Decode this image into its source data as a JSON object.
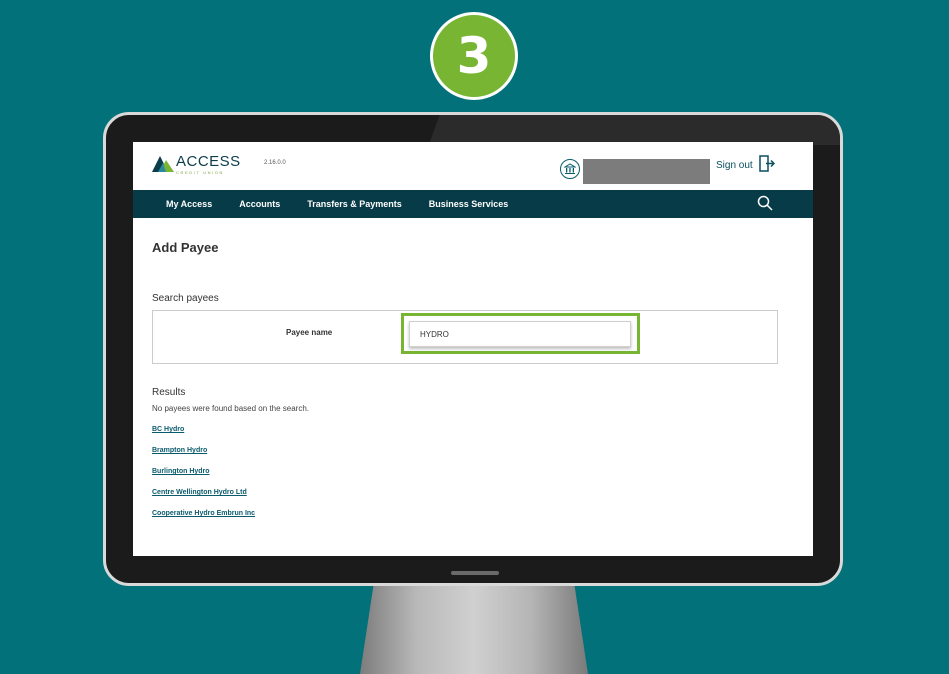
{
  "step_number": "3",
  "header": {
    "logo_title": "ACCESS",
    "logo_subtitle": "CREDIT UNION",
    "version": "2.16.0.0",
    "sign_out_label": "Sign out"
  },
  "nav": {
    "items": [
      "My Access",
      "Accounts",
      "Transfers & Payments",
      "Business Services"
    ]
  },
  "page": {
    "title": "Add Payee",
    "search_section_label": "Search payees",
    "payee_name_label": "Payee name",
    "payee_name_value": "HYDRO"
  },
  "results": {
    "title": "Results",
    "message": "No payees were found based on the search.",
    "items": [
      "BC Hydro",
      "Brampton Hydro",
      "Burlington Hydro",
      "Centre Wellington Hydro Ltd",
      "Cooperative Hydro Embrun Inc"
    ]
  },
  "colors": {
    "background": "#027179",
    "accent_green": "#77b533",
    "nav_bar": "#073b47"
  },
  "icons": {
    "profile": "bank-building-icon",
    "sign_out": "exit-door-icon",
    "search": "search-icon"
  }
}
